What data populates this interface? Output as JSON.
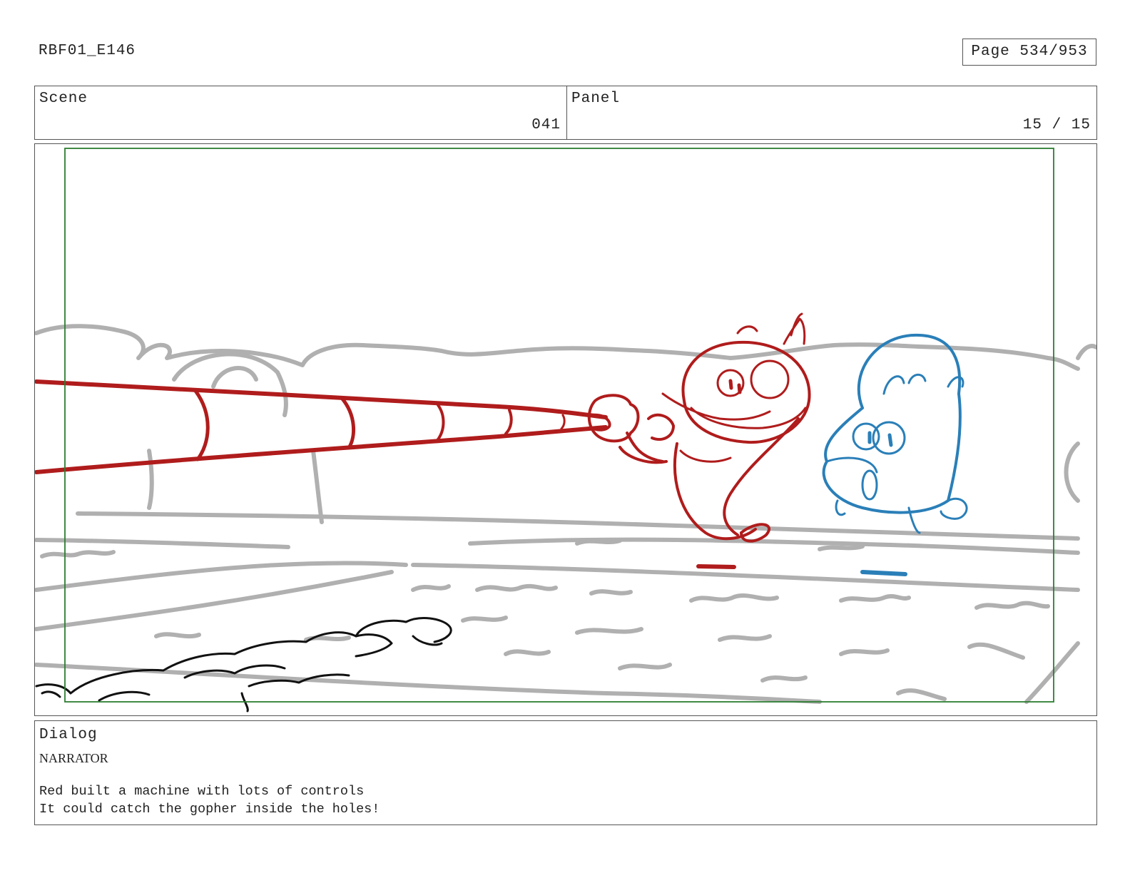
{
  "header": {
    "project": "RBF01_E146",
    "page": "Page 534/953"
  },
  "info": {
    "scene_label": "Scene",
    "scene_value": "041",
    "panel_label": "Panel",
    "panel_value": "15 / 15"
  },
  "dialog": {
    "label": "Dialog",
    "speaker": "NARRATOR",
    "lines": [
      "Red built a machine with lots of controls",
      "It could catch the gopher inside the holes!"
    ]
  },
  "colors": {
    "safe_frame": "#2e7d32",
    "background_sketch": "#b0b0b0",
    "red_character": "#b01c1c",
    "blue_character": "#2a7fb8",
    "dirt": "#111111"
  }
}
